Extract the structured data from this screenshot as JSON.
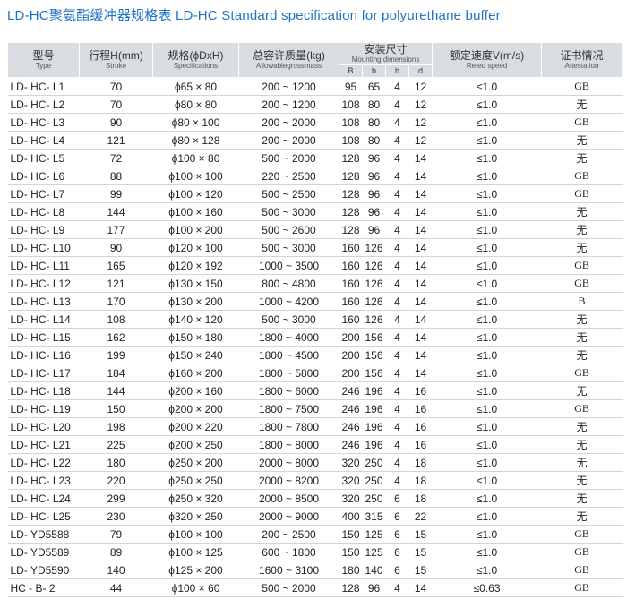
{
  "title": "LD-HC聚氨酯缓冲器规格表 LD-HC Standard specification for polyurethane buffer",
  "headers": {
    "type": {
      "zh": "型号",
      "en": "Type"
    },
    "stroke": {
      "zh": "行程H(mm)",
      "en": "Stroke"
    },
    "spec": {
      "zh": "规格(ϕDxH)",
      "en": "Specifications"
    },
    "mass": {
      "zh": "总容许质量(kg)",
      "en": "Allowablegrossmass"
    },
    "mount": {
      "zh": "安装尺寸",
      "en": "Mounting dimensions"
    },
    "mount_cols": [
      "B",
      "b",
      "h",
      "d"
    ],
    "speed": {
      "zh": "额定速度V(m/s)",
      "en": "Reted speed"
    },
    "cert": {
      "zh": "证书情况",
      "en": "Attestation"
    }
  },
  "rows": [
    [
      "LD- HC- L1",
      "70",
      "ϕ65 × 80",
      "200 ~ 1200",
      "95",
      "65",
      "4",
      "12",
      "≤1.0",
      "GB"
    ],
    [
      "LD- HC- L2",
      "70",
      "ϕ80 × 80",
      "200 ~ 1200",
      "108",
      "80",
      "4",
      "12",
      "≤1.0",
      "无"
    ],
    [
      "LD- HC- L3",
      "90",
      "ϕ80 × 100",
      "200 ~ 2000",
      "108",
      "80",
      "4",
      "12",
      "≤1.0",
      "GB"
    ],
    [
      "LD- HC- L4",
      "121",
      "ϕ80 × 128",
      "200 ~ 2000",
      "108",
      "80",
      "4",
      "12",
      "≤1.0",
      "无"
    ],
    [
      "LD- HC- L5",
      "72",
      "ϕ100 × 80",
      "500 ~ 2000",
      "128",
      "96",
      "4",
      "14",
      "≤1.0",
      "无"
    ],
    [
      "LD- HC- L6",
      "88",
      "ϕ100 × 100",
      "220 ~ 2500",
      "128",
      "96",
      "4",
      "14",
      "≤1.0",
      "GB"
    ],
    [
      "LD- HC- L7",
      "99",
      "ϕ100 × 120",
      "500 ~ 2500",
      "128",
      "96",
      "4",
      "14",
      "≤1.0",
      "GB"
    ],
    [
      "LD- HC- L8",
      "144",
      "ϕ100 × 160",
      "500 ~ 3000",
      "128",
      "96",
      "4",
      "14",
      "≤1.0",
      "无"
    ],
    [
      "LD- HC- L9",
      "177",
      "ϕ100 × 200",
      "500 ~ 2600",
      "128",
      "96",
      "4",
      "14",
      "≤1.0",
      "无"
    ],
    [
      "LD- HC- L10",
      "90",
      "ϕ120 × 100",
      "500 ~ 3000",
      "160",
      "126",
      "4",
      "14",
      "≤1.0",
      "无"
    ],
    [
      "LD- HC- L11",
      "165",
      "ϕ120 × 192",
      "1000 ~ 3500",
      "160",
      "126",
      "4",
      "14",
      "≤1.0",
      "GB"
    ],
    [
      "LD- HC- L12",
      "121",
      "ϕ130 × 150",
      "800 ~ 4800",
      "160",
      "126",
      "4",
      "14",
      "≤1.0",
      "GB"
    ],
    [
      "LD- HC- L13",
      "170",
      "ϕ130 × 200",
      "1000 ~ 4200",
      "160",
      "126",
      "4",
      "14",
      "≤1.0",
      "B"
    ],
    [
      "LD- HC- L14",
      "108",
      "ϕ140 × 120",
      "500 ~ 3000",
      "160",
      "126",
      "4",
      "14",
      "≤1.0",
      "无"
    ],
    [
      "LD- HC- L15",
      "162",
      "ϕ150 × 180",
      "1800 ~ 4000",
      "200",
      "156",
      "4",
      "14",
      "≤1.0",
      "无"
    ],
    [
      "LD- HC- L16",
      "199",
      "ϕ150 × 240",
      "1800 ~ 4500",
      "200",
      "156",
      "4",
      "14",
      "≤1.0",
      "无"
    ],
    [
      "LD- HC- L17",
      "184",
      "ϕ160 × 200",
      "1800 ~ 5800",
      "200",
      "156",
      "4",
      "14",
      "≤1.0",
      "GB"
    ],
    [
      "LD- HC- L18",
      "144",
      "ϕ200 × 160",
      "1800 ~ 6000",
      "246",
      "196",
      "4",
      "16",
      "≤1.0",
      "无"
    ],
    [
      "LD- HC- L19",
      "150",
      "ϕ200 × 200",
      "1800 ~ 7500",
      "246",
      "196",
      "4",
      "16",
      "≤1.0",
      "GB"
    ],
    [
      "LD- HC- L20",
      "198",
      "ϕ200 × 220",
      "1800 ~ 7800",
      "246",
      "196",
      "4",
      "16",
      "≤1.0",
      "无"
    ],
    [
      "LD- HC- L21",
      "225",
      "ϕ200 × 250",
      "1800 ~ 8000",
      "246",
      "196",
      "4",
      "16",
      "≤1.0",
      "无"
    ],
    [
      "LD- HC- L22",
      "180",
      "ϕ250 × 200",
      "2000 ~ 8000",
      "320",
      "250",
      "4",
      "18",
      "≤1.0",
      "无"
    ],
    [
      "LD- HC- L23",
      "220",
      "ϕ250 × 250",
      "2000 ~ 8200",
      "320",
      "250",
      "4",
      "18",
      "≤1.0",
      "无"
    ],
    [
      "LD- HC- L24",
      "299",
      "ϕ250 × 320",
      "2000 ~ 8500",
      "320",
      "250",
      "6",
      "18",
      "≤1.0",
      "无"
    ],
    [
      "LD- HC- L25",
      "230",
      "ϕ320 × 250",
      "2000 ~ 9000",
      "400",
      "315",
      "6",
      "22",
      "≤1.0",
      "无"
    ],
    [
      "LD- YD5588",
      "79",
      "ϕ100 × 100",
      "200 ~ 2500",
      "150",
      "125",
      "6",
      "15",
      "≤1.0",
      "GB"
    ],
    [
      "LD- YD5589",
      "89",
      "ϕ100 × 125",
      "600 ~ 1800",
      "150",
      "125",
      "6",
      "15",
      "≤1.0",
      "GB"
    ],
    [
      "LD- YD5590",
      "140",
      "ϕ125 × 200",
      "1600 ~ 3100",
      "180",
      "140",
      "6",
      "15",
      "≤1.0",
      "GB"
    ],
    [
      "HC - B- 2",
      "44",
      "ϕ100 × 60",
      "500 ~ 2000",
      "128",
      "96",
      "4",
      "14",
      "≤0.63",
      "GB"
    ]
  ],
  "colors": {
    "title": "#1e73c6",
    "header_bg": "#d9dde2",
    "row_line": "#c9d6e3"
  }
}
